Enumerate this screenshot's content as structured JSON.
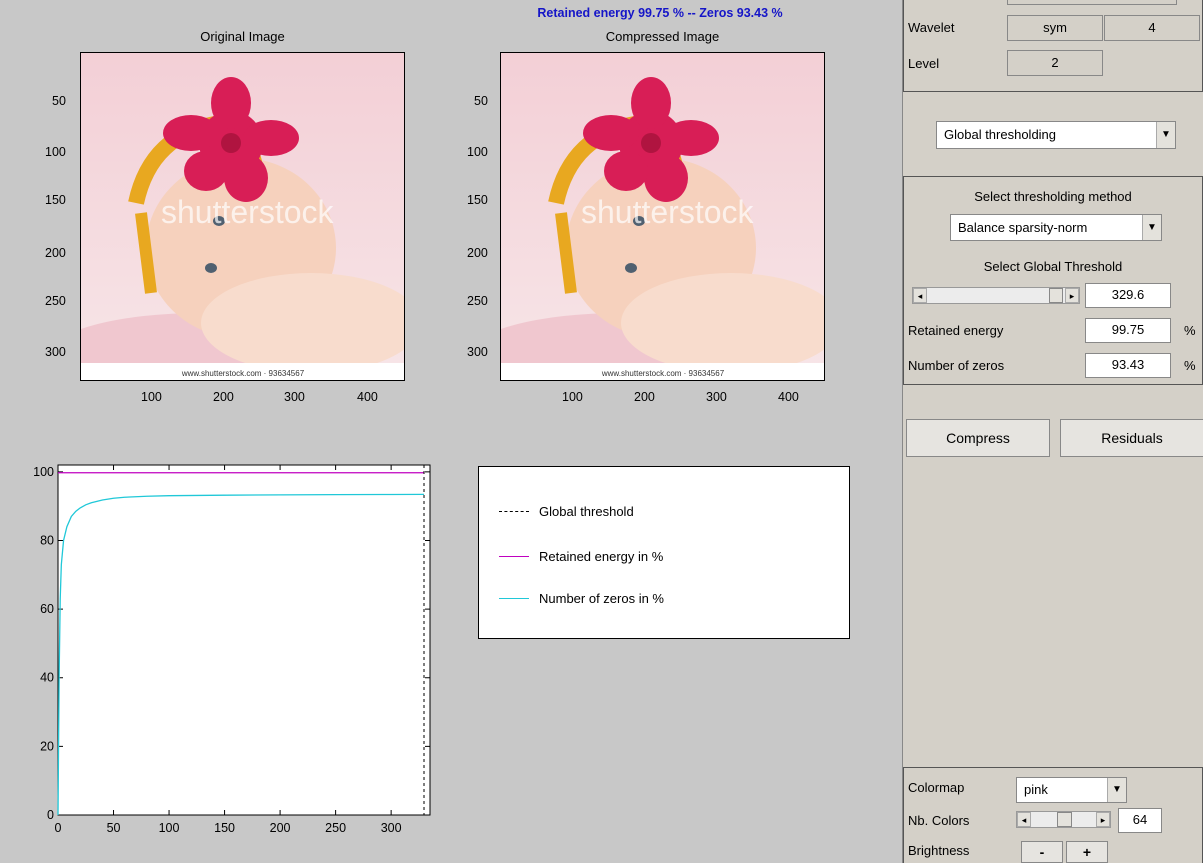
{
  "header": {
    "summary_title": "Retained energy 99.75 % -- Zeros 93.43 %"
  },
  "original_axes": {
    "title": "Original Image",
    "yticks": [
      "50",
      "100",
      "150",
      "200",
      "250",
      "300"
    ],
    "xticks": [
      "100",
      "200",
      "300",
      "400"
    ],
    "watermark": "shutterstock",
    "caption": "www.shutterstock.com · 93634567"
  },
  "compressed_axes": {
    "title": "Compressed Image",
    "yticks": [
      "50",
      "100",
      "150",
      "200",
      "250",
      "300"
    ],
    "xticks": [
      "100",
      "200",
      "300",
      "400"
    ],
    "watermark": "shutterstock",
    "caption": "www.shutterstock.com · 93634567"
  },
  "chart_data": {
    "type": "line",
    "xlim": [
      0,
      335
    ],
    "ylim": [
      0,
      102
    ],
    "xticks": [
      0,
      50,
      100,
      150,
      200,
      250,
      300
    ],
    "yticks": [
      0,
      20,
      40,
      60,
      80,
      100
    ],
    "series": [
      {
        "name": "Retained energy in %",
        "color": "#c000c0",
        "x": [
          0,
          329.6
        ],
        "y": [
          99.75,
          99.75
        ]
      },
      {
        "name": "Number of zeros in %",
        "color": "#20c8d8",
        "x": [
          0,
          1,
          2,
          3,
          5,
          8,
          12,
          16,
          20,
          25,
          30,
          40,
          50,
          60,
          80,
          100,
          150,
          200,
          250,
          300,
          329.6
        ],
        "y": [
          0,
          40,
          63,
          73,
          80,
          84,
          87,
          88.5,
          89.5,
          90.4,
          91,
          91.8,
          92.3,
          92.6,
          92.9,
          93.05,
          93.2,
          93.3,
          93.37,
          93.41,
          93.43
        ]
      }
    ],
    "threshold": {
      "name": "Global threshold",
      "x": 329.6,
      "color": "#000000"
    }
  },
  "panel": {
    "wavelet_label": "Wavelet",
    "wavelet_family": "sym",
    "wavelet_order": "4",
    "level_label": "Level",
    "level_value": "2",
    "thresholding_mode": "Global thresholding",
    "method_title": "Select thresholding method",
    "method_value": "Balance sparsity-norm",
    "global_thr_title": "Select Global Threshold",
    "threshold_value": "329.6",
    "threshold_fraction": 0.97,
    "retained_label": "Retained energy",
    "retained_value": "99.75",
    "zeros_label": "Number of zeros",
    "zeros_value": "93.43",
    "percent": "%",
    "compress_label": "Compress",
    "residuals_label": "Residuals",
    "colormap_label": "Colormap",
    "colormap_value": "pink",
    "nbcolors_label": "Nb. Colors",
    "nbcolors_value": "64",
    "brightness_label": "Brightness",
    "brightness_minus": "-",
    "brightness_plus": "+"
  }
}
